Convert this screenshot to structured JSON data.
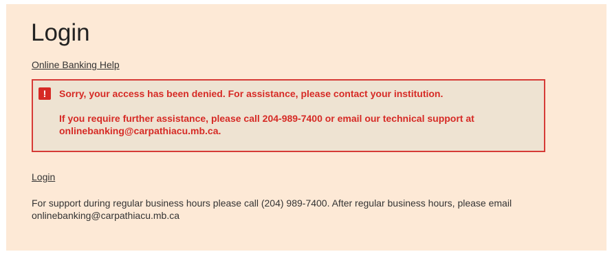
{
  "page": {
    "title": "Login",
    "help_link": "Online Banking Help"
  },
  "error": {
    "icon": "alert-icon",
    "icon_glyph": "!",
    "message": "Sorry, your access has been denied. For assistance, please contact your institution.",
    "assistance": "If you require further assistance, please call 204-989-7400 or email our technical support at onlinebanking@carpathiacu.mb.ca.",
    "color": "#d62a25"
  },
  "footer": {
    "login_link": "Login",
    "support_text": "For support during regular business hours please call (204) 989-7400. After regular business hours, please email onlinebanking@carpathiacu.mb.ca"
  },
  "colors": {
    "background": "#fde9d6",
    "error_border": "#d63a36",
    "error_background": "#eee3d2"
  }
}
